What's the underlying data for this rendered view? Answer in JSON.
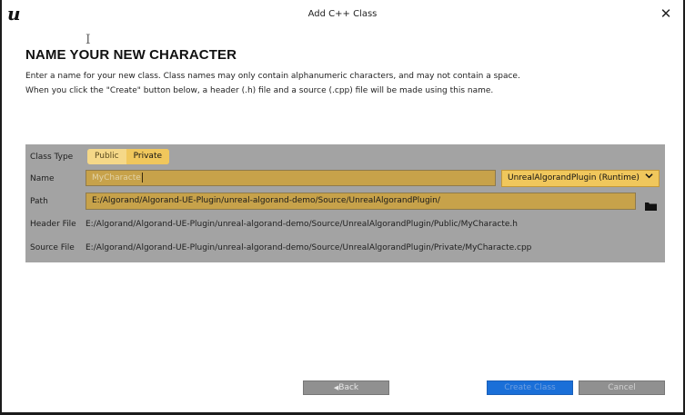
{
  "window": {
    "title": "Add C++ Class",
    "logo_letter": "u",
    "close_glyph": "✕",
    "cursor_glyph": "I"
  },
  "page": {
    "heading": "NAME YOUR NEW CHARACTER",
    "description_line1": "Enter a name for your new class. Class names may only contain alphanumeric characters, and may not contain a space.",
    "description_line2": "When you click the \"Create\" button below, a header (.h) file and a source (.cpp) file will be made using this name."
  },
  "form": {
    "class_type_label": "Class Type",
    "class_type_options": [
      "Public",
      "Private"
    ],
    "class_type_selected": "Private",
    "name_label": "Name",
    "name_value": "MyCharacte",
    "module_label": "UnrealAlgorandPlugin (Runtime)",
    "module_chevron": "❯",
    "path_label": "Path",
    "path_value": "E:/Algorand/Algorand-UE-Plugin/unreal-algorand-demo/Source/UnrealAlgorandPlugin/",
    "header_file_label": "Header File",
    "header_file_value": "E:/Algorand/Algorand-UE-Plugin/unreal-algorand-demo/Source/UnrealAlgorandPlugin/Public/MyCharacte.h",
    "source_file_label": "Source File",
    "source_file_value": "E:/Algorand/Algorand-UE-Plugin/unreal-algorand-demo/Source/UnrealAlgorandPlugin/Private/MyCharacte.cpp"
  },
  "footer": {
    "back_label": "Back",
    "back_glyph": "◀",
    "create_label": "Create Class",
    "cancel_label": "Cancel"
  },
  "colors": {
    "accent_gold": "#f0c75c",
    "field_gold": "#c7a24a",
    "panel_gray": "#a3a3a3",
    "create_blue": "#1a6fd8"
  }
}
